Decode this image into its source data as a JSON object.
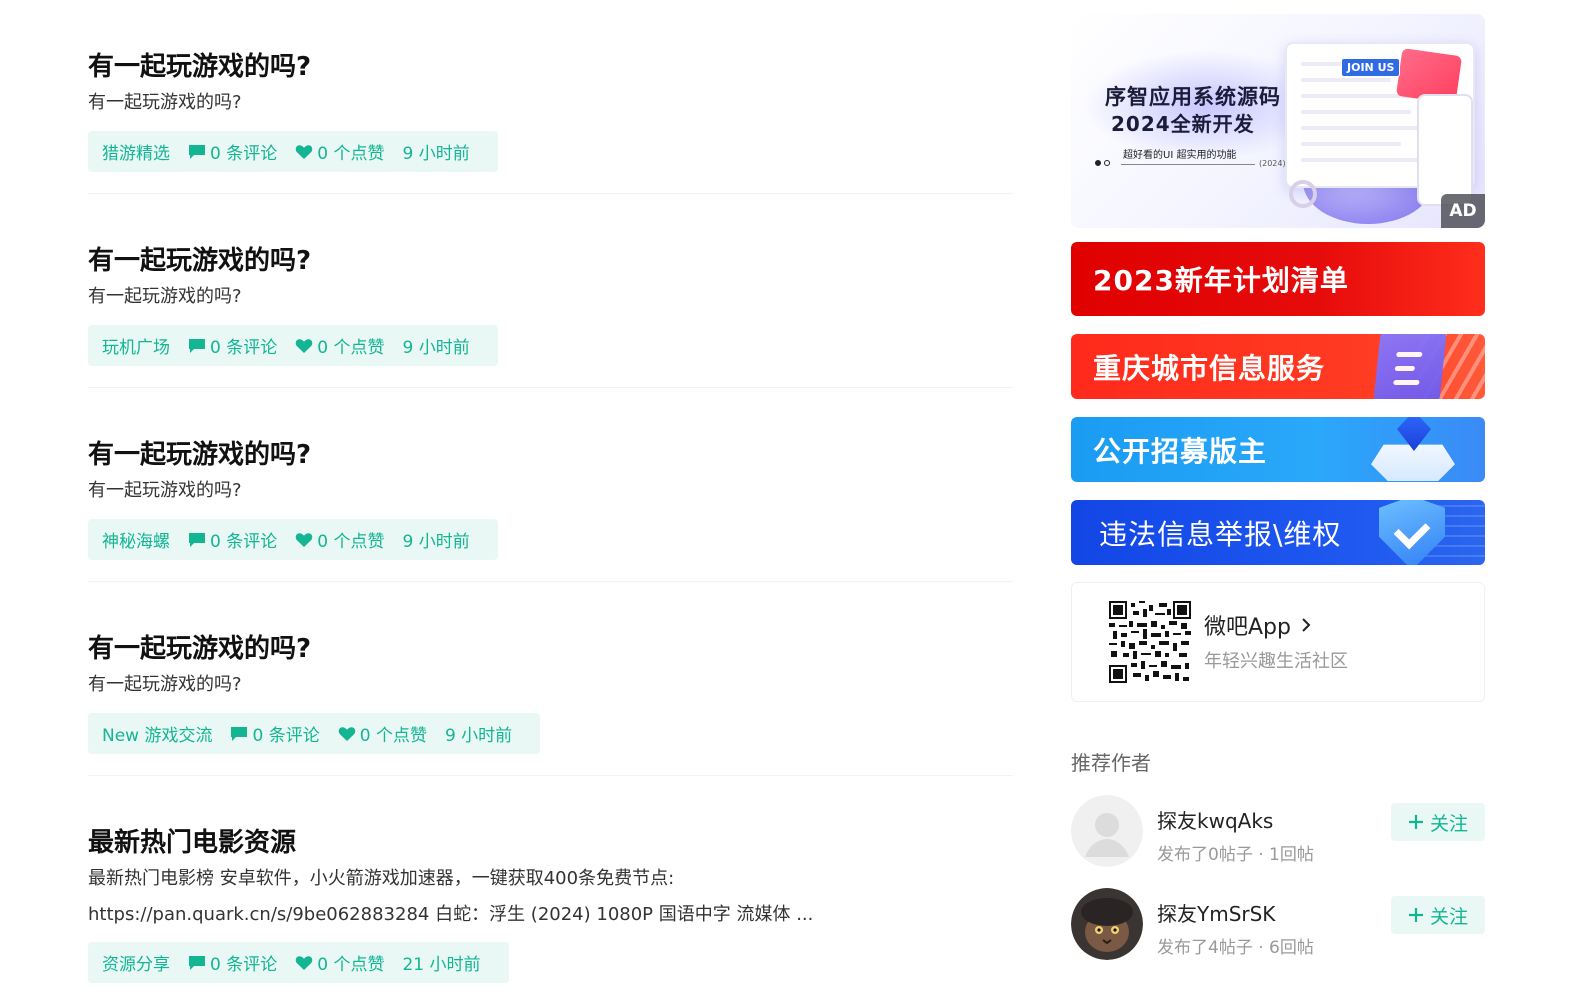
{
  "posts": [
    {
      "title": "有一起玩游戏的吗?",
      "excerpt": "有一起玩游戏的吗?",
      "category": "猎游精选",
      "comments": "0 条评论",
      "likes": "0 个点赞",
      "time": "9 小时前"
    },
    {
      "title": "有一起玩游戏的吗?",
      "excerpt": "有一起玩游戏的吗?",
      "category": "玩机广场",
      "comments": "0 条评论",
      "likes": "0 个点赞",
      "time": "9 小时前"
    },
    {
      "title": "有一起玩游戏的吗?",
      "excerpt": "有一起玩游戏的吗?",
      "category": "神秘海螺",
      "comments": "0 条评论",
      "likes": "0 个点赞",
      "time": "9 小时前"
    },
    {
      "title": "有一起玩游戏的吗?",
      "excerpt": "有一起玩游戏的吗?",
      "category": "New 游戏交流",
      "comments": "0 条评论",
      "likes": "0 个点赞",
      "time": "9 小时前"
    },
    {
      "title": "最新热门电影资源",
      "excerpt_line1": "最新热门电影榜 安卓软件，小火箭游戏加速器，一键获取400条免费节点:",
      "excerpt_line2": "https://pan.quark.cn/s/9be062883284 白蛇：浮生 (2024) 1080P 国语中字 流媒体 ...",
      "category": "资源分享",
      "comments": "0 条评论",
      "likes": "0 个点赞",
      "time": "21 小时前"
    }
  ],
  "ad": {
    "line1": "序智应用系统源码",
    "line2": "2024全新开发",
    "line3": "超好看的UI 超实用的功能",
    "year": "(2024)",
    "join": "JOIN US",
    "badge": "AD"
  },
  "banners": [
    {
      "label": "2023新年计划清单",
      "color": "#e00000"
    },
    {
      "label": "重庆城市信息服务",
      "color": "#ff2a1c"
    },
    {
      "label": "公开招募版主",
      "color": "#1a9cf2"
    },
    {
      "label": "违法信息举报\\维权",
      "color": "#1246e6"
    }
  ],
  "app": {
    "name": "微吧App",
    "subtitle": "年轻兴趣生活社区"
  },
  "recommend": {
    "title": "推荐作者",
    "follow_label": "关注",
    "authors": [
      {
        "name": "探友kwqAks",
        "stats": "发布了0帖子 · 1回帖"
      },
      {
        "name": "探友YmSrSK",
        "stats": "发布了4帖子 · 6回帖"
      }
    ]
  },
  "theme": {
    "accent": "#13b593",
    "accent_bg": "#e9f8f5"
  }
}
